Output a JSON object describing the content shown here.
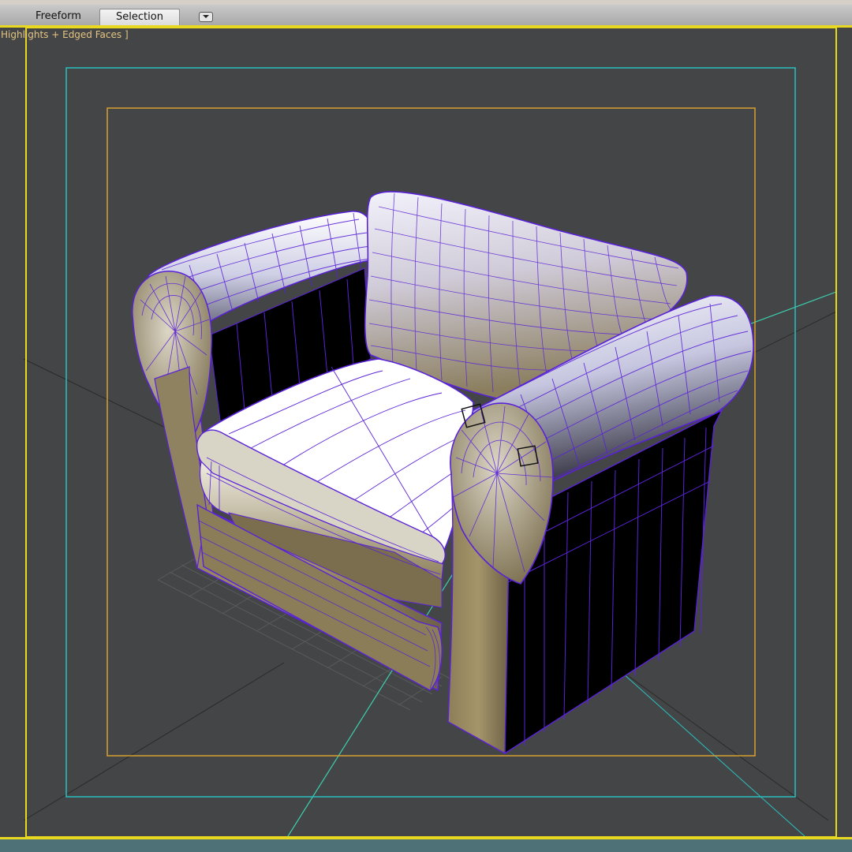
{
  "ribbon": {
    "tabs": [
      {
        "label": "Freeform",
        "active": false
      },
      {
        "label": "Selection",
        "active": true
      }
    ],
    "dropdown_icon": "chevron-down-icon"
  },
  "viewport": {
    "label": "Highlights + Edged Faces ]"
  },
  "colors": {
    "active_viewport_border": "#e8d820",
    "safe_frame_outer": "#2bbfbf",
    "safe_frame_inner": "#d9a030",
    "wireframe": "#5a22d8",
    "viewport_background": "#444546"
  }
}
